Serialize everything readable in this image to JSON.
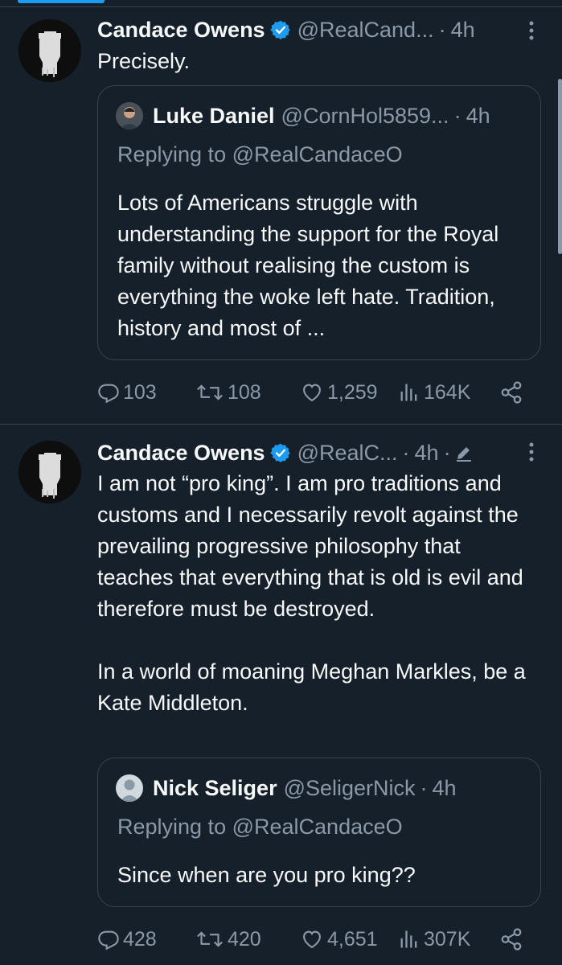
{
  "tweets": [
    {
      "author_name": "Candace Owens",
      "handle": "@RealCand...",
      "time": "4h",
      "text": "Precisely.",
      "quote": {
        "author_name": "Luke Daniel",
        "handle": "@CornHol5859...",
        "time": "4h",
        "replying_label": "Replying to",
        "replying_to": "@RealCandaceO",
        "text": "Lots of Americans struggle with understanding the support for the Royal family without realising the custom is everything the woke left hate. Tradition, history and most of ..."
      },
      "stats": {
        "replies": "103",
        "retweets": "108",
        "likes": "1,259",
        "views": "164K"
      }
    },
    {
      "author_name": "Candace Owens",
      "handle": "@RealC...",
      "time": "4h",
      "text": "I am not “pro king”. I am pro traditions and customs and I necessarily revolt against the prevailing progressive philosophy that teaches that everything that is old is evil and therefore must be destroyed.\n\nIn a world of moaning Meghan Markles, be a Kate Middleton.",
      "quote": {
        "author_name": "Nick Seliger",
        "handle": "@SeligerNick",
        "time": "4h",
        "replying_label": "Replying to",
        "replying_to": "@RealCandaceO",
        "text": "Since when are you pro king??"
      },
      "stats": {
        "replies": "428",
        "retweets": "420",
        "likes": "4,651",
        "views": "307K"
      }
    }
  ],
  "separator": "·",
  "colors": {
    "background": "#15202b",
    "accent": "#1d9bf0",
    "muted": "#8b98a5",
    "border": "#38444d"
  }
}
